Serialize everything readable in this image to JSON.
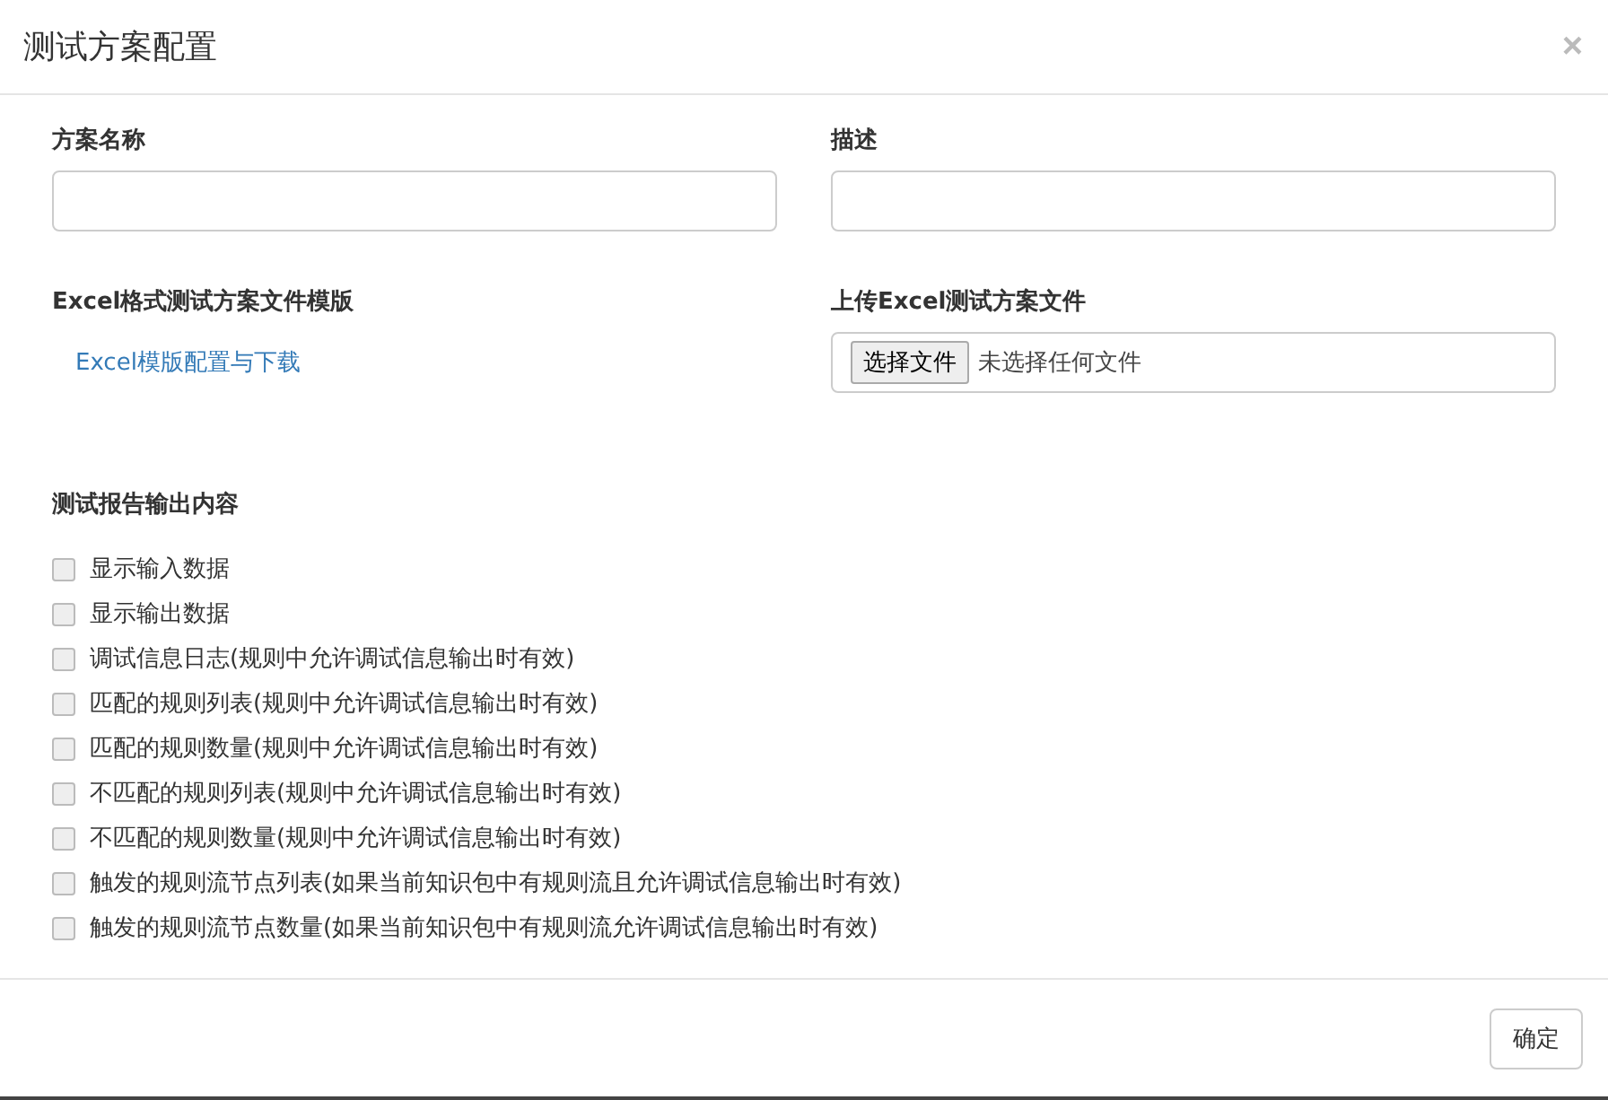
{
  "dialog": {
    "title": "测试方案配置",
    "close": "×"
  },
  "fields": [
    {
      "label": "方案名称",
      "kind": "text"
    },
    {
      "label": "描述",
      "kind": "text"
    },
    {
      "label": "Excel格式测试方案文件模版",
      "kind": "link",
      "link": "Excel模版配置与下载"
    },
    {
      "label": "上传Excel测试方案文件",
      "kind": "file",
      "button": "选择文件",
      "status": "未选择任何文件"
    }
  ],
  "report": {
    "title": "测试报告输出内容",
    "options": [
      {
        "label": "显示输入数据",
        "checked": false
      },
      {
        "label": "显示输出数据",
        "checked": false
      },
      {
        "label": "调试信息日志(规则中允许调试信息输出时有效)",
        "checked": false
      },
      {
        "label": "匹配的规则列表(规则中允许调试信息输出时有效)",
        "checked": false
      },
      {
        "label": "匹配的规则数量(规则中允许调试信息输出时有效)",
        "checked": false
      },
      {
        "label": "不匹配的规则列表(规则中允许调试信息输出时有效)",
        "checked": false
      },
      {
        "label": "不匹配的规则数量(规则中允许调试信息输出时有效)",
        "checked": false
      },
      {
        "label": "触发的规则流节点列表(如果当前知识包中有规则流且允许调试信息输出时有效)",
        "checked": false
      },
      {
        "label": "触发的规则流节点数量(如果当前知识包中有规则流允许调试信息输出时有效)",
        "checked": false
      }
    ]
  },
  "buttons": [
    "确定"
  ]
}
